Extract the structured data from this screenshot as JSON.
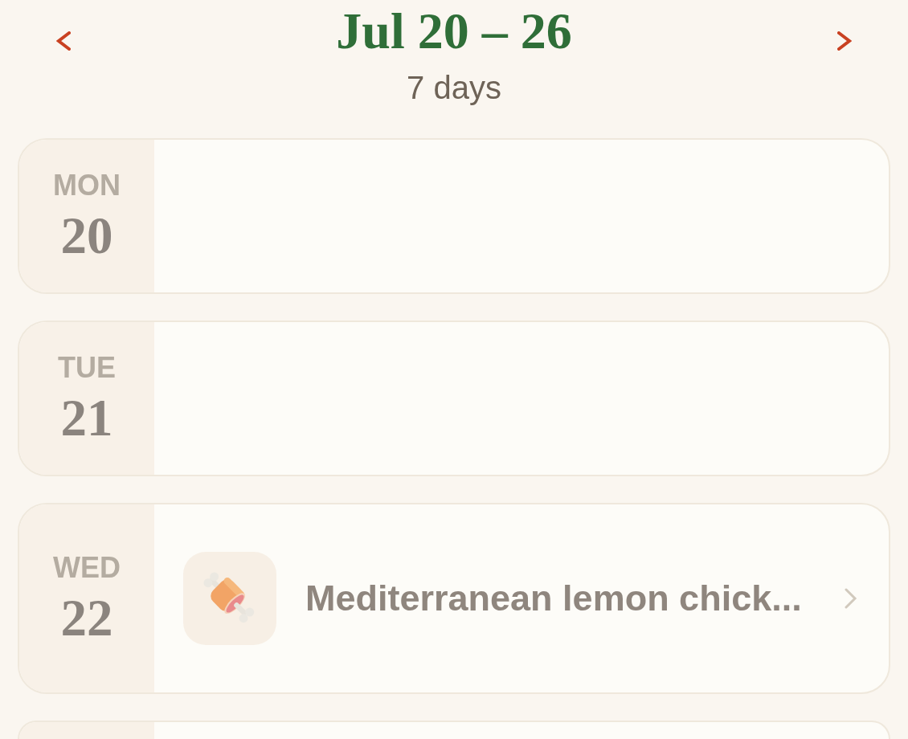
{
  "header": {
    "title": "Jul 20 – 26",
    "subtitle": "7 days"
  },
  "days": [
    {
      "weekday": "MON",
      "date": "20"
    },
    {
      "weekday": "TUE",
      "date": "21"
    },
    {
      "weekday": "WED",
      "date": "22",
      "meals": [
        {
          "title": "Mediterranean lemon chick..."
        }
      ]
    }
  ],
  "more_days_below": true
}
